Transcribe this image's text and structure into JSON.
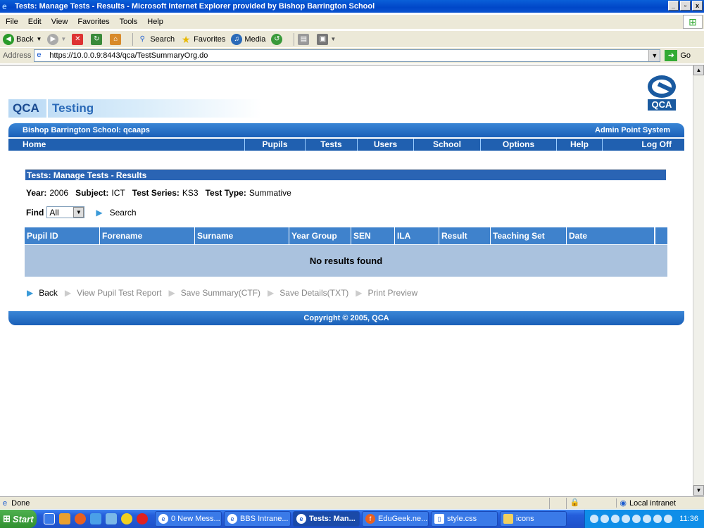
{
  "window": {
    "title": "Tests: Manage Tests - Results - Microsoft Internet Explorer provided by Bishop Barrington School"
  },
  "menu": [
    "File",
    "Edit",
    "View",
    "Favorites",
    "Tools",
    "Help"
  ],
  "toolbar": {
    "back": "Back",
    "search": "Search",
    "favorites": "Favorites",
    "media": "Media"
  },
  "address": {
    "label": "Address",
    "url": "https://10.0.0.9:8443/qca/TestSummaryOrg.do",
    "go": "Go"
  },
  "brand": {
    "logo_text": "QCA",
    "qca": "QCA",
    "testing": "Testing"
  },
  "schoolbar": {
    "school": "Bishop Barrington School: qcaaps",
    "system": "Admin Point System"
  },
  "nav": [
    "Home",
    "Pupils",
    "Tests",
    "Users",
    "School",
    "Options",
    "Help",
    "Log Off"
  ],
  "page": {
    "title": "Tests: Manage Tests - Results",
    "filters": {
      "year_label": "Year:",
      "year": "2006",
      "subject_label": "Subject:",
      "subject": "ICT",
      "series_label": "Test Series:",
      "series": "KS3",
      "type_label": "Test Type:",
      "type": "Summative"
    },
    "find_label": "Find",
    "find_value": "All",
    "search_label": "Search"
  },
  "table": {
    "columns": [
      "Pupil ID",
      "Forename",
      "Surname",
      "Year Group",
      "SEN",
      "ILA",
      "Result",
      "Teaching Set",
      "Date"
    ],
    "empty": "No results found"
  },
  "actions": {
    "back": "Back",
    "report": "View Pupil Test Report",
    "summary": "Save Summary(CTF)",
    "details": "Save Details(TXT)",
    "print": "Print Preview"
  },
  "footer": "Copyright © 2005, QCA",
  "status": {
    "done": "Done",
    "zone": "Local intranet"
  },
  "taskbar": {
    "start": "Start",
    "tasks": [
      "0 New Mess...",
      "BBS Intrane...",
      "Tests: Man...",
      "EduGeek.ne...",
      "style.css",
      "icons"
    ],
    "clock": "11:36"
  }
}
